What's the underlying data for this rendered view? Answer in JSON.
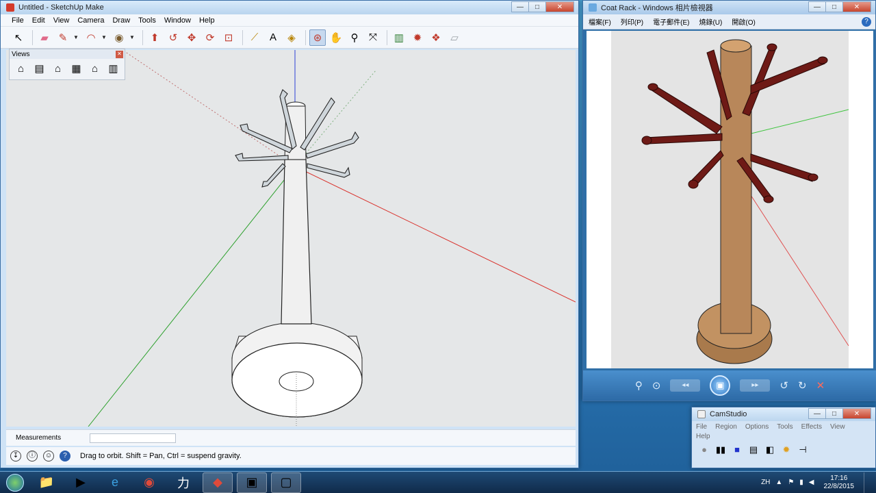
{
  "sketchup": {
    "title": "Untitled - SketchUp Make",
    "menus": [
      "File",
      "Edit",
      "View",
      "Camera",
      "Draw",
      "Tools",
      "Window",
      "Help"
    ],
    "toolbar_icons": [
      "select-icon",
      "eraser-icon",
      "pencil-icon",
      "arc-icon",
      "shape-icon",
      "push-pull-icon",
      "follow-me-icon",
      "move-icon",
      "rotate-icon",
      "scale-icon",
      "tape-measure-icon",
      "text-icon",
      "paint-bucket-icon",
      "orbit-icon",
      "pan-icon",
      "zoom-icon",
      "zoom-extents-icon",
      "3d-warehouse-icon",
      "extension-warehouse-icon",
      "layout-icon",
      "send-to-layout-icon"
    ],
    "views_panel": {
      "title": "Views",
      "icons": [
        "iso-view-icon",
        "top-view-icon",
        "front-view-icon",
        "right-view-icon",
        "back-view-icon",
        "left-view-icon"
      ]
    },
    "measurements_label": "Measurements",
    "measurements_value": "",
    "status_message": "Drag to orbit. Shift = Pan, Ctrl = suspend gravity.",
    "axis_colors": {
      "red": "#d9302a",
      "green": "#2ca02c",
      "blue": "#2b3fd6"
    }
  },
  "photoviewer": {
    "title": "Coat Rack - Windows 相片檢視器",
    "menus": [
      "檔案(F)",
      "列印(P)",
      "電子郵件(E)",
      "燒錄(U)",
      "開啟(O)"
    ],
    "help": "?",
    "colors": {
      "wood": "#b8875a",
      "hooks": "#6e1a16"
    }
  },
  "camstudio": {
    "title": "CamStudio",
    "menus": [
      "File",
      "Region",
      "Options",
      "Tools",
      "Effects",
      "View",
      "Help"
    ]
  },
  "taskbar": {
    "ime": "ZH",
    "time": "17:16",
    "date": "22/8/2015"
  }
}
